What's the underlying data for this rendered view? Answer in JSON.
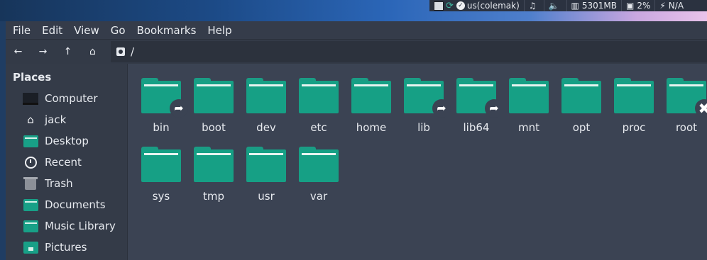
{
  "systray": {
    "keyboard": "us(colemak)",
    "music_icon": "music-note-icon",
    "volume_icon": "speaker-icon",
    "memory": "5301MB",
    "cpu": "2%",
    "battery": "N/A"
  },
  "menubar": {
    "items": [
      "File",
      "Edit",
      "View",
      "Go",
      "Bookmarks",
      "Help"
    ]
  },
  "toolbar": {
    "back": "←",
    "forward": "→",
    "up": "↑",
    "home": "⌂",
    "path": "/"
  },
  "sidebar": {
    "title": "Places",
    "items": [
      {
        "label": "Computer",
        "icon": "computer-icon"
      },
      {
        "label": "jack",
        "icon": "home-icon"
      },
      {
        "label": "Desktop",
        "icon": "desktop-folder-icon"
      },
      {
        "label": "Recent",
        "icon": "clock-icon"
      },
      {
        "label": "Trash",
        "icon": "trash-icon"
      },
      {
        "label": "Documents",
        "icon": "folder-icon"
      },
      {
        "label": "Music Library",
        "icon": "folder-icon"
      },
      {
        "label": "Pictures",
        "icon": "pictures-folder-icon"
      }
    ]
  },
  "files": [
    {
      "name": "bin",
      "emblem": "symlink"
    },
    {
      "name": "boot",
      "emblem": ""
    },
    {
      "name": "dev",
      "emblem": ""
    },
    {
      "name": "etc",
      "emblem": ""
    },
    {
      "name": "home",
      "emblem": ""
    },
    {
      "name": "lib",
      "emblem": "symlink"
    },
    {
      "name": "lib64",
      "emblem": "symlink"
    },
    {
      "name": "mnt",
      "emblem": ""
    },
    {
      "name": "opt",
      "emblem": ""
    },
    {
      "name": "proc",
      "emblem": ""
    },
    {
      "name": "root",
      "emblem": "no-access"
    },
    {
      "name": "sys",
      "emblem": ""
    },
    {
      "name": "tmp",
      "emblem": ""
    },
    {
      "name": "usr",
      "emblem": ""
    },
    {
      "name": "var",
      "emblem": ""
    }
  ],
  "colors": {
    "folder": "#16a085",
    "background": "#3b4353",
    "sidebar": "#343b48"
  }
}
